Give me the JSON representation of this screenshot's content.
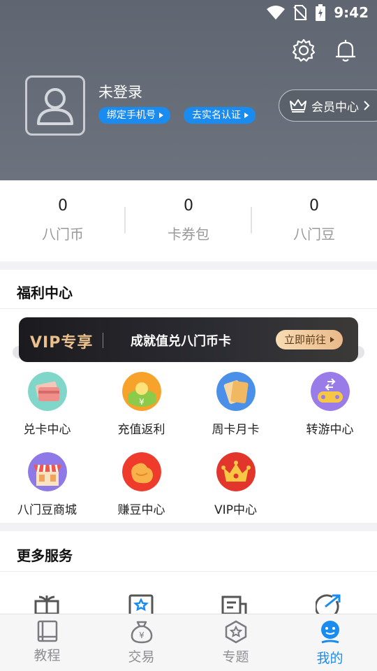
{
  "status_bar": {
    "time": "9:42"
  },
  "profile": {
    "login_status": "未登录",
    "bind_phone": "绑定手机号",
    "real_name_auth": "去实名认证",
    "vip_center": "会员中心"
  },
  "stats": [
    {
      "value": "0",
      "label": "八门币"
    },
    {
      "value": "0",
      "label": "卡券包"
    },
    {
      "value": "0",
      "label": "八门豆"
    }
  ],
  "welfare": {
    "title": "福利中心",
    "banner": {
      "tag": "VIP专享",
      "slogan": "成就值兑八门币卡",
      "button": "立即前往"
    },
    "items": [
      {
        "label": "兑卡中心",
        "icon": "card-exchange-icon"
      },
      {
        "label": "充值返利",
        "icon": "recharge-rebate-icon"
      },
      {
        "label": "周卡月卡",
        "icon": "week-month-card-icon"
      },
      {
        "label": "转游中心",
        "icon": "game-transfer-icon"
      },
      {
        "label": "八门豆商城",
        "icon": "bean-mall-icon"
      },
      {
        "label": "赚豆中心",
        "icon": "earn-beans-icon"
      },
      {
        "label": "VIP中心",
        "icon": "vip-crown-icon"
      }
    ]
  },
  "more_services": {
    "title": "更多服务"
  },
  "bottom_nav": [
    {
      "label": "教程",
      "icon": "book-icon",
      "active": false
    },
    {
      "label": "交易",
      "icon": "money-bag-icon",
      "active": false
    },
    {
      "label": "专题",
      "icon": "star-hexagon-icon",
      "active": false
    },
    {
      "label": "我的",
      "icon": "user-face-icon",
      "active": true
    }
  ],
  "colors": {
    "accent": "#1a8cf0",
    "header_bg": "#656c77",
    "banner_gold": "#e9c08d"
  }
}
